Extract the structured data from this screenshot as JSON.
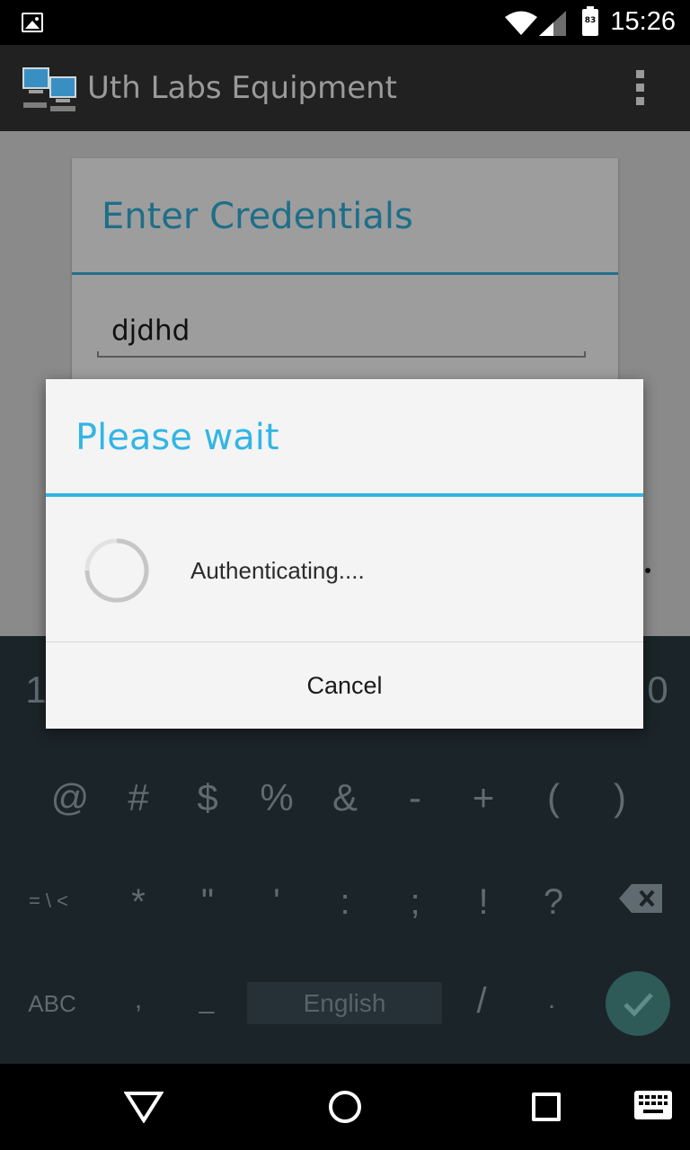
{
  "status_bar": {
    "time": "15:26",
    "battery_level": "83",
    "icons": [
      "gallery-icon",
      "wifi-icon",
      "cell-signal-icon",
      "battery-icon"
    ]
  },
  "app_bar": {
    "title": "Uth Labs Equipment",
    "icons": [
      "app-logo-icon",
      "overflow-menu-icon"
    ]
  },
  "credentials_card": {
    "title": "Enter Credentials",
    "username_value": "djdhd"
  },
  "dialog": {
    "title": "Please wait",
    "message": "Authenticating....",
    "cancel_label": "Cancel",
    "accent_color": "#33b5e5"
  },
  "keyboard": {
    "number_row_left": "1",
    "number_row_right": "0",
    "symbols_row1": [
      "@",
      "#",
      "$",
      "%",
      "&",
      "-",
      "+",
      "(",
      ")"
    ],
    "symbols_row2": [
      "= \\ <",
      "*",
      "\"",
      "'",
      ":",
      ";",
      "!",
      "?"
    ],
    "bottom_row": {
      "abc_label": "ABC",
      "comma": ",",
      "underscore": "_",
      "space_label": "English",
      "slash": "/",
      "period": "."
    },
    "icons": [
      "delete-icon",
      "checkmark-icon"
    ]
  },
  "nav_bar": {
    "icons": [
      "back-icon",
      "home-icon",
      "recent-apps-icon",
      "keyboard-icon"
    ]
  }
}
